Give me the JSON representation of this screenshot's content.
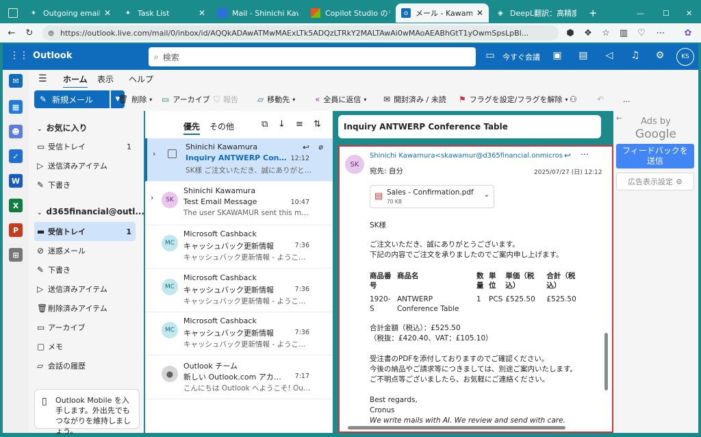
{
  "browser": {
    "tabs": [
      {
        "label": "Outgoing email",
        "active": false
      },
      {
        "label": "Task List",
        "active": false
      },
      {
        "label": "Mail - Shinichi Kawam",
        "active": false
      },
      {
        "label": "Copilot Studio のライ",
        "active": false
      },
      {
        "label": "メール - Kawamura Sh",
        "active": true
      },
      {
        "label": "DeepL翻訳：高精度",
        "active": false
      }
    ],
    "url": "https://outlook.live.com/mail/0/inbox/id/AQQkADAwATMwMAExLTk5ADQzLTRkY2MALTAwAi0wMAoAEABhGtT1yOwmSpsLpBl..."
  },
  "header": {
    "app_name": "Outlook",
    "search_placeholder": "検索",
    "meet_now": "今すぐ会議",
    "avatar_initials": "KS"
  },
  "ribbon": {
    "tabs": [
      "ホーム",
      "表示",
      "ヘルプ"
    ],
    "new_mail": "新規メール",
    "delete": "削除",
    "archive": "アーカイブ",
    "report": "報告",
    "move_to": "移動先",
    "reply_all": "全員に返信",
    "read_unread": "開封済み / 未読",
    "flag": "フラグを設定/フラグを解除",
    "more": "..."
  },
  "folders": {
    "favorites_header": "お気に入り",
    "favorites": [
      {
        "label": "受信トレイ",
        "count": "1",
        "icon": "inbox-icon"
      },
      {
        "label": "送信済みアイテム",
        "count": "",
        "icon": "send-icon"
      },
      {
        "label": "下書き",
        "count": "",
        "icon": "draft-icon"
      }
    ],
    "account_header": "d365financial@outl...",
    "account": [
      {
        "label": "受信トレイ",
        "count": "1",
        "icon": "inbox-icon"
      },
      {
        "label": "迷惑メール",
        "count": "",
        "icon": "junk-icon"
      },
      {
        "label": "下書き",
        "count": "",
        "icon": "draft-icon"
      },
      {
        "label": "送信済みアイテム",
        "count": "",
        "icon": "send-icon"
      },
      {
        "label": "削除済みアイテム",
        "count": "",
        "icon": "trash-icon"
      },
      {
        "label": "アーカイブ",
        "count": "",
        "icon": "archive-icon"
      },
      {
        "label": "メモ",
        "count": "",
        "icon": "note-icon"
      },
      {
        "label": "会話の履歴",
        "count": "",
        "icon": "history-icon"
      }
    ],
    "promo_text": "Outlook Mobile を入手します。外出先でもつながりを維持しましょう。"
  },
  "message_list": {
    "focused_tab": "優先",
    "other_tab": "その他",
    "items": [
      {
        "sender": "Shinichi Kawamura",
        "subject": "Inquiry ANTWERP Conferen...",
        "time": "12:12",
        "preview": "SK様 ご注文いただき、誠にありがとうござい...",
        "initials": "",
        "selected": true
      },
      {
        "sender": "Shinichi Kawamura",
        "subject": "Test Email Message",
        "time": "10:47",
        "preview": "The user SKAWAMUR sent this mess...",
        "initials": "SK",
        "selected": false
      },
      {
        "sender": "Microsoft Cashback",
        "subject": "キャッシュバック更新情報",
        "time": "7:36",
        "preview": "キャッシュバック更新情報 - ようこそShini...",
        "initials": "MC",
        "selected": false
      },
      {
        "sender": "Microsoft Cashback",
        "subject": "キャッシュバック更新情報",
        "time": "7:36",
        "preview": "キャッシュバック更新情報 - ようこそShini...",
        "initials": "MC",
        "selected": false
      },
      {
        "sender": "Microsoft Cashback",
        "subject": "キャッシュバック更新情報",
        "time": "7:36",
        "preview": "キャッシュバック更新情報 - ようこそShini...",
        "initials": "MC",
        "selected": false
      },
      {
        "sender": "Outlook チーム",
        "subject": "新しい Outlook.com アカウントへ...",
        "time": "7:17",
        "preview": "こんにちは Outlook へようこそ! Outlook...",
        "initials": "",
        "selected": false
      }
    ]
  },
  "reading_pane": {
    "subject": "Inquiry ANTWERP Conference Table",
    "from": "Shinichi Kawamura<skawamur@d365financial.onmicrosoft.co",
    "sender_initials": "SK",
    "to": "宛先: 自分",
    "date": "2025/07/27 (日) 12:12",
    "attachment_name": "Sales - Confirmation.pdf",
    "attachment_size": "70 KB",
    "greeting": "SK様",
    "intro1": "ご注文いただき、誠にありがとうございます。",
    "intro2": "下記の内容でご注文を承りましたのでご案内申し上げます。",
    "table_headers": [
      "商品番号",
      "商品名",
      "数量",
      "単位",
      "単価（税込）",
      "合計（税込）"
    ],
    "table_row": [
      "1920-S",
      "ANTWERP Conference Table",
      "1",
      "PCS",
      "£525.50",
      "£525.50"
    ],
    "total1": "合計金額（税込）：£525.50",
    "total2": "（税抜：£420.40、VAT：£105.10）",
    "note1": "受注書のPDFを添付しておりますのでご確認ください。",
    "note2": "今後の納品やご請求等につきましては、別途ご案内いたします。",
    "note3": "ご不明点等ございましたら、お気軽にご連絡ください。",
    "regards": "Best regards,",
    "signature": "Cronus",
    "tagline": "We write mails with AI. We review and send with care."
  },
  "ads": {
    "ads_by": "Ads by",
    "google": "Google",
    "feedback": "フィードバックを送信",
    "settings": "広告表示設定"
  },
  "colors": {
    "brand": "#0f6cbd",
    "browser_frame": "#1a8c8c",
    "highlight_border": "#d13438",
    "selected_bg": "#cfe4fa"
  }
}
